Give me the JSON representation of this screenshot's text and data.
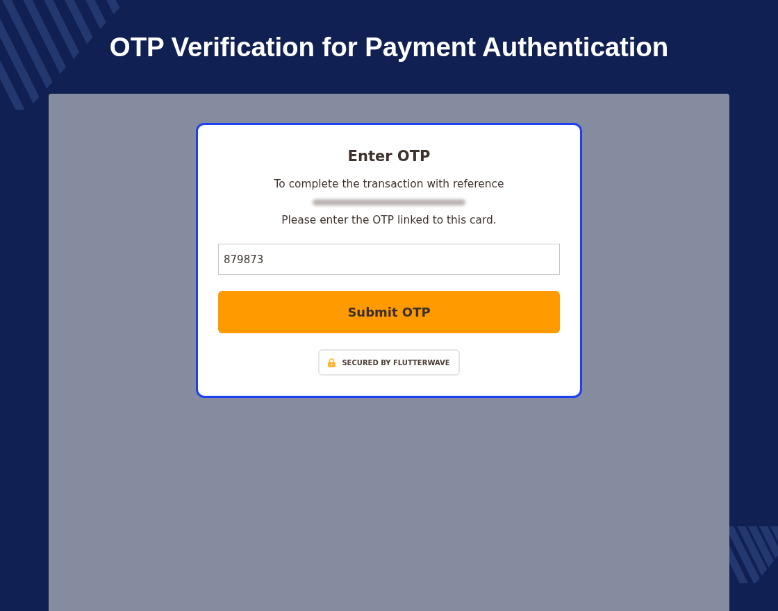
{
  "page": {
    "title": "OTP Verification for Payment Authentication"
  },
  "otp_card": {
    "heading": "Enter OTP",
    "instruction": "To complete the transaction with reference",
    "reference_blurred": true,
    "prompt": "Please enter the OTP linked to this card.",
    "otp_field": {
      "value": "879873"
    },
    "submit_button": {
      "label": "Submit OTP"
    },
    "security_badge": {
      "label": "SECURED BY FLUTTERWAVE"
    }
  }
}
